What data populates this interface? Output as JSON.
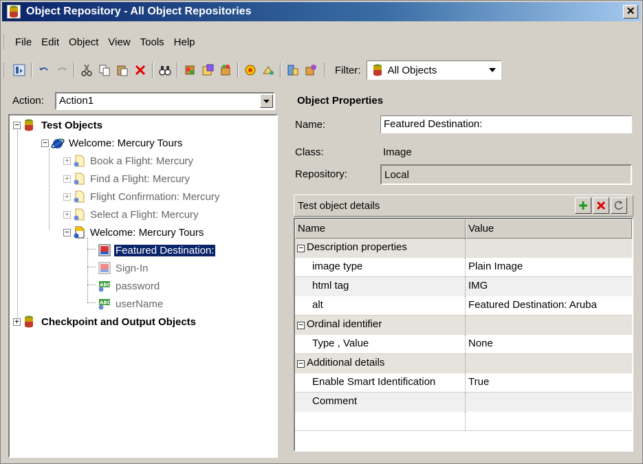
{
  "window": {
    "title": "Object Repository - All Object Repositories",
    "close_glyph": "✕"
  },
  "menu": [
    "File",
    "Edit",
    "Object",
    "View",
    "Tools",
    "Help"
  ],
  "toolbar": {
    "filter_label": "Filter:",
    "filter_value": "All Objects"
  },
  "action": {
    "label": "Action:",
    "value": "Action1"
  },
  "tree": {
    "test_objects": "Test Objects",
    "welcome_browser": "Welcome: Mercury Tours",
    "pages": [
      "Book a Flight: Mercury",
      "Find a Flight: Mercury",
      "Flight Confirmation: Mercury",
      "Select a Flight: Mercury"
    ],
    "welcome_page": "Welcome: Mercury Tours",
    "objects": [
      "Featured Destination:",
      "Sign-In",
      "password",
      "userName"
    ],
    "checkpoints": "Checkpoint and Output Objects"
  },
  "properties": {
    "title": "Object Properties",
    "name_label": "Name:",
    "name_value": "Featured Destination:",
    "class_label": "Class:",
    "class_value": "Image",
    "repository_label": "Repository:",
    "repository_value": "Local",
    "details_title": "Test object details"
  },
  "grid": {
    "headers": [
      "Name",
      "Value"
    ],
    "rows": [
      {
        "type": "category",
        "name": "Description properties",
        "value": ""
      },
      {
        "type": "property",
        "name": "image type",
        "value": "Plain Image"
      },
      {
        "type": "property",
        "name": "html tag",
        "value": "IMG"
      },
      {
        "type": "property",
        "name": "alt",
        "value": "Featured Destination: Aruba"
      },
      {
        "type": "category",
        "name": "Ordinal identifier",
        "value": ""
      },
      {
        "type": "property",
        "name": "Type , Value",
        "value": "None"
      },
      {
        "type": "category",
        "name": "Additional details",
        "value": ""
      },
      {
        "type": "property",
        "name": "Enable Smart Identification",
        "value": "True"
      },
      {
        "type": "property",
        "name": "Comment",
        "value": ""
      }
    ]
  },
  "colors": {
    "selection": "#0a246a",
    "title_gradient_start": "#0a246a",
    "title_gradient_end": "#a6caf0",
    "window_bg": "#d4d0c8"
  }
}
